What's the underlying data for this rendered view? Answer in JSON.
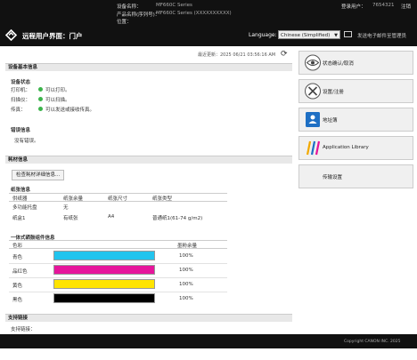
{
  "device_info": {
    "name_label": "设备名称：",
    "name_value": "MF660C Series",
    "product_label": "产品名称(序列号)：",
    "product_value": "MF660C Series (XXXXXXXXXX)",
    "location_label": "位置："
  },
  "user": {
    "label": "登录用户：",
    "value": "7654321",
    "logout": "注销"
  },
  "header": {
    "title": "远程用户界面：门户",
    "language_label": "Language:",
    "language_value": "Chinese (Simplified)",
    "admin_link": "发送电子邮件至管理员"
  },
  "last_updated": "最近更新：2025 06/21 03:56:16 AM",
  "basic": {
    "section_title": "设备基本信息",
    "status_title": "设备状态",
    "rows": [
      {
        "label": "打印机：",
        "text": "可以打印。"
      },
      {
        "label": "扫描仪：",
        "text": "可以扫描。"
      },
      {
        "label": "传真：",
        "text": "可以发送或接收传真。"
      }
    ],
    "error_title": "错误信息",
    "error_text": "没有错误。"
  },
  "consumables": {
    "section_title": "耗材信息",
    "check_button": "检查耗材详细信息...",
    "paper_title": "纸张信息",
    "paper_headers": [
      "供纸器",
      "纸张余量",
      "纸张尺寸",
      "纸张类型"
    ],
    "paper_rows": [
      [
        "多功能托盘",
        "无",
        "",
        ""
      ],
      [
        "纸盒1",
        "有纸张",
        "A4",
        "普通纸1(61-74 g/m2)"
      ]
    ],
    "cart_title": "一体式硒鼓组件信息",
    "cart_headers": [
      "色彩",
      "墨粉余量"
    ],
    "cartridges": [
      {
        "name": "青色",
        "color": "#22c4ee",
        "level": "100%"
      },
      {
        "name": "品红色",
        "color": "#e6159b",
        "level": "100%"
      },
      {
        "name": "黄色",
        "color": "#ffe400",
        "level": "100%"
      },
      {
        "name": "黑色",
        "color": "#000000",
        "level": "100%"
      }
    ]
  },
  "support": {
    "section_title": "支持链接",
    "link_label": "支持链接："
  },
  "sidebar": [
    {
      "label": "状态确认/取消",
      "icon": "eye-icon"
    },
    {
      "label": "设置/注册",
      "icon": "tools-icon"
    },
    {
      "label": "地址簿",
      "icon": "address-book-icon"
    },
    {
      "label": "Application Library",
      "icon": "app-library-icon"
    },
    {
      "label": "传输设置",
      "icon": ""
    }
  ],
  "footer": {
    "copyright": "Copyright CANON INC. 2025"
  }
}
